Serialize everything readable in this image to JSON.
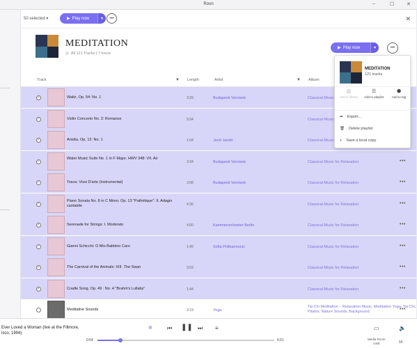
{
  "window": {
    "title": "Roon"
  },
  "selection": {
    "count_label": "50 selected",
    "play_label": "Play now"
  },
  "playlist": {
    "title": "MEDITATION",
    "meta": "All 121 Tracks | 7 hours",
    "play_label": "Play now"
  },
  "columns": {
    "track": "Track",
    "length": "Length",
    "artist": "Artist",
    "album": "Album"
  },
  "rows": [
    {
      "title": "Waltz, Op. 54: No. 1",
      "length": "3:39",
      "artist": "Budapesti Vonósok",
      "album": "Classical Music for Relaxation",
      "selected": true
    },
    {
      "title": "Violin Concerto No. 2: Romance",
      "length": "9:34",
      "artist": "",
      "album": "Classical Music for Relaxation",
      "selected": true
    },
    {
      "title": "Arietta, Op. 12: No. 1",
      "length": "1:04",
      "artist": "Jenő Jandó",
      "album": "Classical Music for Relaxation",
      "selected": true
    },
    {
      "title": "Water Music Suite No. 1 in F Major, HWV 348: VII. Air",
      "length": "3:34",
      "artist": "Budapesti Vonósok",
      "album": "Classical Music for Relaxation",
      "selected": true
    },
    {
      "title": "Tosca: Vissi D'arte (Instrumental)",
      "length": "3:08",
      "artist": "Budapesti Vonósok",
      "album": "Classical Music for Relaxation",
      "selected": true
    },
    {
      "title": "Piano Sonata No. 8 in C Minor, Op. 13 \"Pathétique\": II. Adagio cantabile",
      "length": "4:36",
      "artist": "",
      "album": "Classical Music for Relaxation",
      "selected": true
    },
    {
      "title": "Serenade for Strings: I. Moderato",
      "length": "4:00",
      "artist": "Kammerorchester Berlin",
      "album": "Classical Music for Relaxation",
      "selected": true
    },
    {
      "title": "Gianni Schicchi: O Mio Babbino Caro",
      "length": "1:45",
      "artist": "Sofia Philharmonic",
      "album": "Classical Music for Relaxation",
      "selected": true
    },
    {
      "title": "The Carnival of the Animals: XIII. The Swan",
      "length": "3:03",
      "artist": "",
      "album": "Classical Music for Relaxation",
      "selected": true
    },
    {
      "title": "Cradle Song, Op. 49 : No. 4 \"Brahm's Lullaby\"",
      "length": "1:44",
      "artist": "",
      "album": "Classical Music for Relaxation",
      "selected": true
    },
    {
      "title": "Meditative Sounds",
      "length": "3:19",
      "artist": "Yoga",
      "album": "Tai Chi Meditation – Relaxation Music, Meditation Yoga, Tai Chi, Pilates, Nature Sounds, Background",
      "selected": false
    }
  ],
  "popup": {
    "title": "MEDITATION",
    "count": "121 tracks",
    "actions": {
      "add_library": "Add to library",
      "add_playlist": "Add to playlist",
      "add_tag": "Add to tag"
    },
    "items": {
      "export": "Export...",
      "delete": "Delete playlist",
      "save_local": "Save a local copy"
    }
  },
  "player": {
    "now_playing_line1": "Ever Loved a Woman (live at the Fillmore,",
    "now_playing_line2": "isco, 1994)",
    "elapsed": "0:54",
    "total": "6:51",
    "progress": 0.13,
    "zone_line1": "Media Room",
    "zone_line2": "USB",
    "volume": "55"
  },
  "accent_color": "#7a6ff0"
}
